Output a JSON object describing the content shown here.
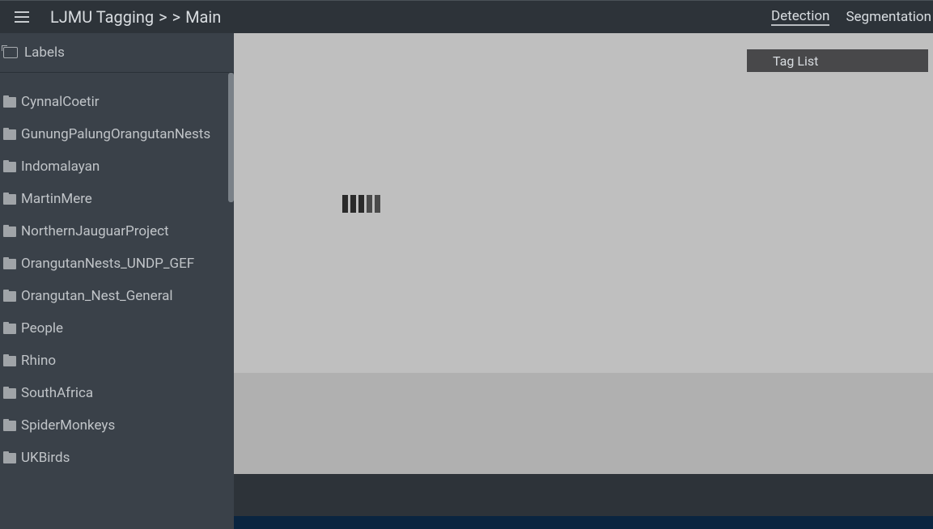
{
  "header": {
    "app_title": "LJMU Tagging",
    "breadcrumb_sep1": ">",
    "breadcrumb_sep2": ">",
    "breadcrumb_current": "Main",
    "tabs": [
      {
        "label": "Detection",
        "active": true
      },
      {
        "label": "Segmentation",
        "active": false
      }
    ]
  },
  "sidebar": {
    "labels_title": "Labels",
    "folders": [
      {
        "name": "CynnalCoetir"
      },
      {
        "name": "GunungPalungOrangutanNests"
      },
      {
        "name": "Indomalayan"
      },
      {
        "name": "MartinMere"
      },
      {
        "name": "NorthernJauguarProject"
      },
      {
        "name": "OrangutanNests_UNDP_GEF"
      },
      {
        "name": "Orangutan_Nest_General"
      },
      {
        "name": "People"
      },
      {
        "name": "Rhino"
      },
      {
        "name": "SouthAfrica"
      },
      {
        "name": "SpiderMonkeys"
      },
      {
        "name": "UKBirds"
      }
    ]
  },
  "canvas": {
    "tag_list_label": "Tag List"
  }
}
